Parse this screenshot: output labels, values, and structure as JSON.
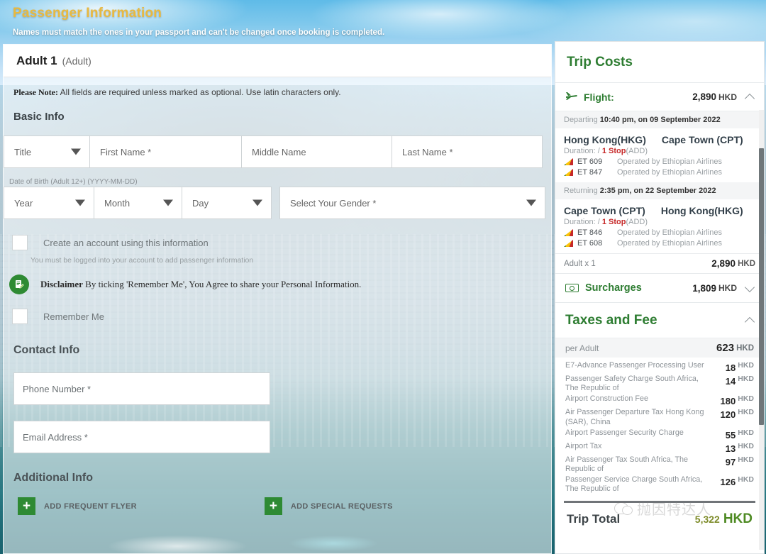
{
  "header": {
    "title": "Passenger Information",
    "subtitle": "Names must match the ones in your passport and can't be changed once booking is completed.",
    "title_color": "#e8b93f"
  },
  "passenger": {
    "heading": "Adult 1",
    "type": "(Adult)",
    "note_label": "Please Note:",
    "note_text": "All fields are required unless marked as optional. Use latin characters only.",
    "basic_info_title": "Basic Info",
    "fields": {
      "title": "Title",
      "first_name": "First Name *",
      "middle_name": "Middle Name",
      "last_name": "Last Name *",
      "dob_label": "Date of Birth (Adult 12+) (YYYY-MM-DD)",
      "year": "Year",
      "month": "Month",
      "day": "Day",
      "gender": "Select Your Gender *"
    },
    "create_account_label": "Create an account using this information",
    "create_account_help": "You must be logged into your account to add passenger information",
    "disclaimer_label": "Disclaimer",
    "disclaimer_text": "By ticking 'Remember Me', You Agree to share your Personal Information.",
    "remember_me_label": "Remember Me"
  },
  "contact": {
    "title": "Contact Info",
    "phone_placeholder": "Phone Number *",
    "email_placeholder": "Email Address *"
  },
  "additional": {
    "title": "Additional Info",
    "frequent_flyer_label": "ADD FREQUENT FLYER",
    "special_requests_label": "ADD SPECIAL REQUESTS",
    "plus": "+"
  },
  "trip_costs": {
    "title": "Trip Costs",
    "flight": {
      "label": "Flight:",
      "amount": "2,890",
      "currency": "HKD"
    },
    "outbound": {
      "band_label": "Departing",
      "band_value": "10:40 pm, on 09 September 2022",
      "from": "Hong Kong(HKG)",
      "to": "Cape Town (CPT)",
      "duration_label": "Duration:",
      "duration_value": "/",
      "stops": "1 Stop",
      "stop_airport": "(ADD)",
      "segments": [
        {
          "number": "ET 609",
          "operator": "Operated by Ethiopian Airlines"
        },
        {
          "number": "ET 847",
          "operator": "Operated by Ethiopian Airlines"
        }
      ]
    },
    "inbound": {
      "band_label": "Returning",
      "band_value": "2:35 pm, on 22 September 2022",
      "from": "Cape Town (CPT)",
      "to": "Hong Kong(HKG)",
      "duration_label": "Duration:",
      "duration_value": "/",
      "stops": "1 Stop",
      "stop_airport": "(ADD)",
      "segments": [
        {
          "number": "ET 846",
          "operator": "Operated by Ethiopian Airlines"
        },
        {
          "number": "ET 608",
          "operator": "Operated by Ethiopian Airlines"
        }
      ]
    },
    "adult_line": {
      "label": "Adult x 1",
      "amount": "2,890",
      "currency": "HKD"
    },
    "surcharges": {
      "label": "Surcharges",
      "amount": "1,809",
      "currency": "HKD"
    },
    "taxes": {
      "title": "Taxes and Fee",
      "per_adult_label": "per Adult",
      "per_adult_amount": "623",
      "per_adult_currency": "HKD",
      "items": [
        {
          "name": "E7-Advance Passenger Processing User",
          "amount": "18",
          "currency": "HKD"
        },
        {
          "name": "Passenger Safety Charge South Africa, The Republic of",
          "amount": "14",
          "currency": "HKD"
        },
        {
          "name": " Airport Construction Fee",
          "amount": "180",
          "currency": "HKD"
        },
        {
          "name": "Air Passenger Departure Tax Hong Kong (SAR), China",
          "amount": "120",
          "currency": "HKD"
        },
        {
          "name": "Airport Passenger Security Charge",
          "amount": "55",
          "currency": "HKD"
        },
        {
          "name": "Airport Tax",
          "amount": "13",
          "currency": "HKD"
        },
        {
          "name": "Air Passenger Tax South Africa, The Republic of",
          "amount": "97",
          "currency": "HKD"
        },
        {
          "name": "Passenger Service Charge South Africa, The Republic of",
          "amount": "126",
          "currency": "HKD"
        }
      ]
    },
    "total": {
      "label": "Trip Total",
      "amount": "5,322",
      "currency": "HKD"
    }
  },
  "watermark": {
    "text": "抛因特达人"
  },
  "colors": {
    "brand_green": "#2e7d32",
    "accent_gold": "#e8b93f",
    "alert_red": "#c62828"
  }
}
